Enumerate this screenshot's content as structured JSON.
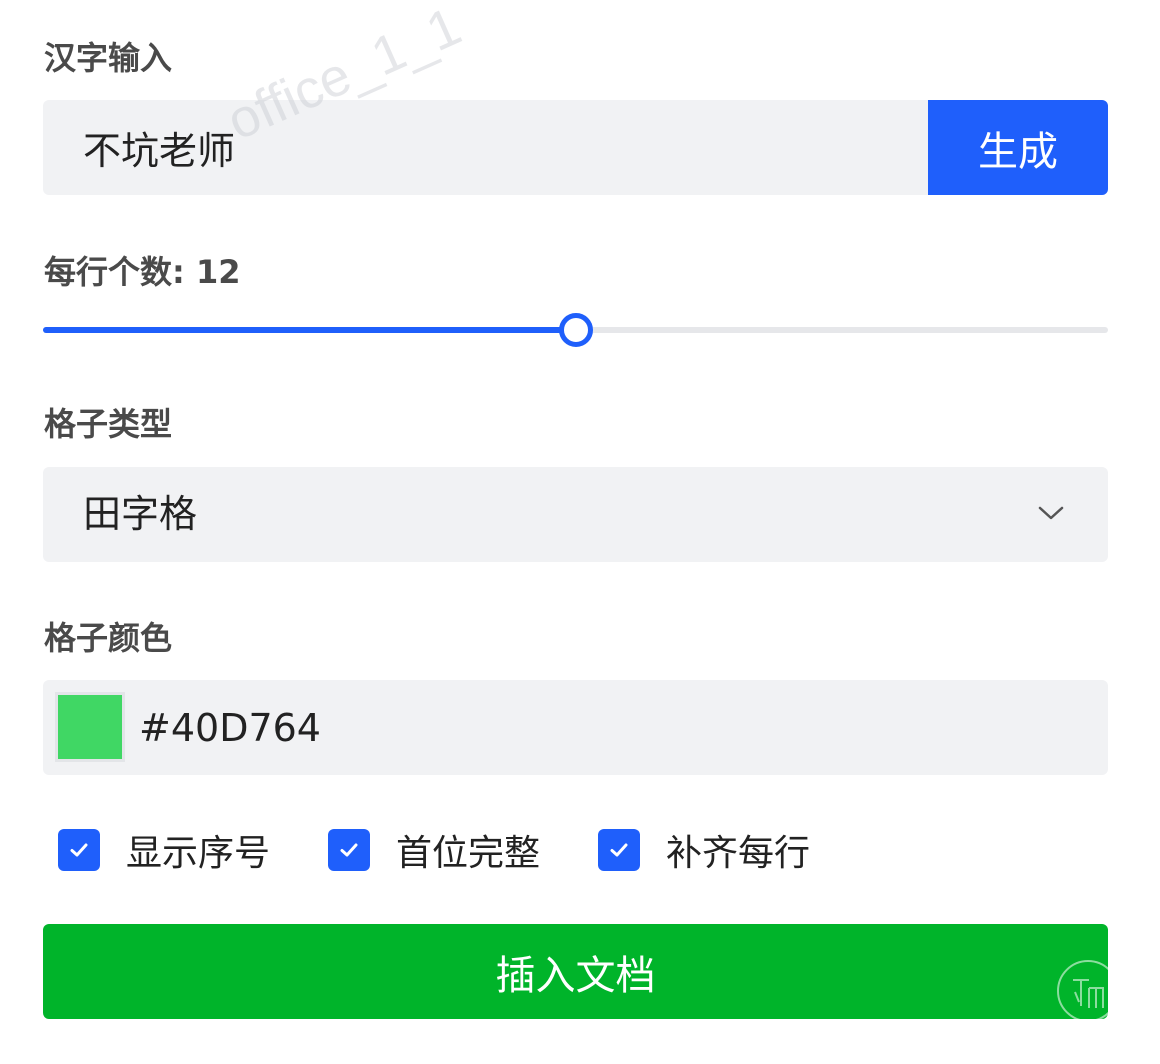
{
  "hanzi_section": {
    "label": "汉字输入",
    "input_value": "不坑老师",
    "watermark": "office_1_1",
    "generate_label": "生成"
  },
  "per_row_section": {
    "label_prefix": "每行个数: ",
    "value": 12,
    "slider_fraction": 0.5
  },
  "grid_type_section": {
    "label": "格子类型",
    "selected": "田字格"
  },
  "grid_color_section": {
    "label": "格子颜色",
    "hex_value": "#40D764",
    "swatch_color": "#40D764"
  },
  "options": [
    {
      "label": "显示序号",
      "checked": true
    },
    {
      "label": "首位完整",
      "checked": true
    },
    {
      "label": "补齐每行",
      "checked": true
    }
  ],
  "insert_label": "插入文档",
  "colors": {
    "primary": "#1f5ffb",
    "success": "#00b42a",
    "field_bg": "#f1f2f4"
  },
  "icons": {
    "select": "chevron-down-icon",
    "checkbox": "check-icon",
    "corner": "seal-logo-icon"
  }
}
